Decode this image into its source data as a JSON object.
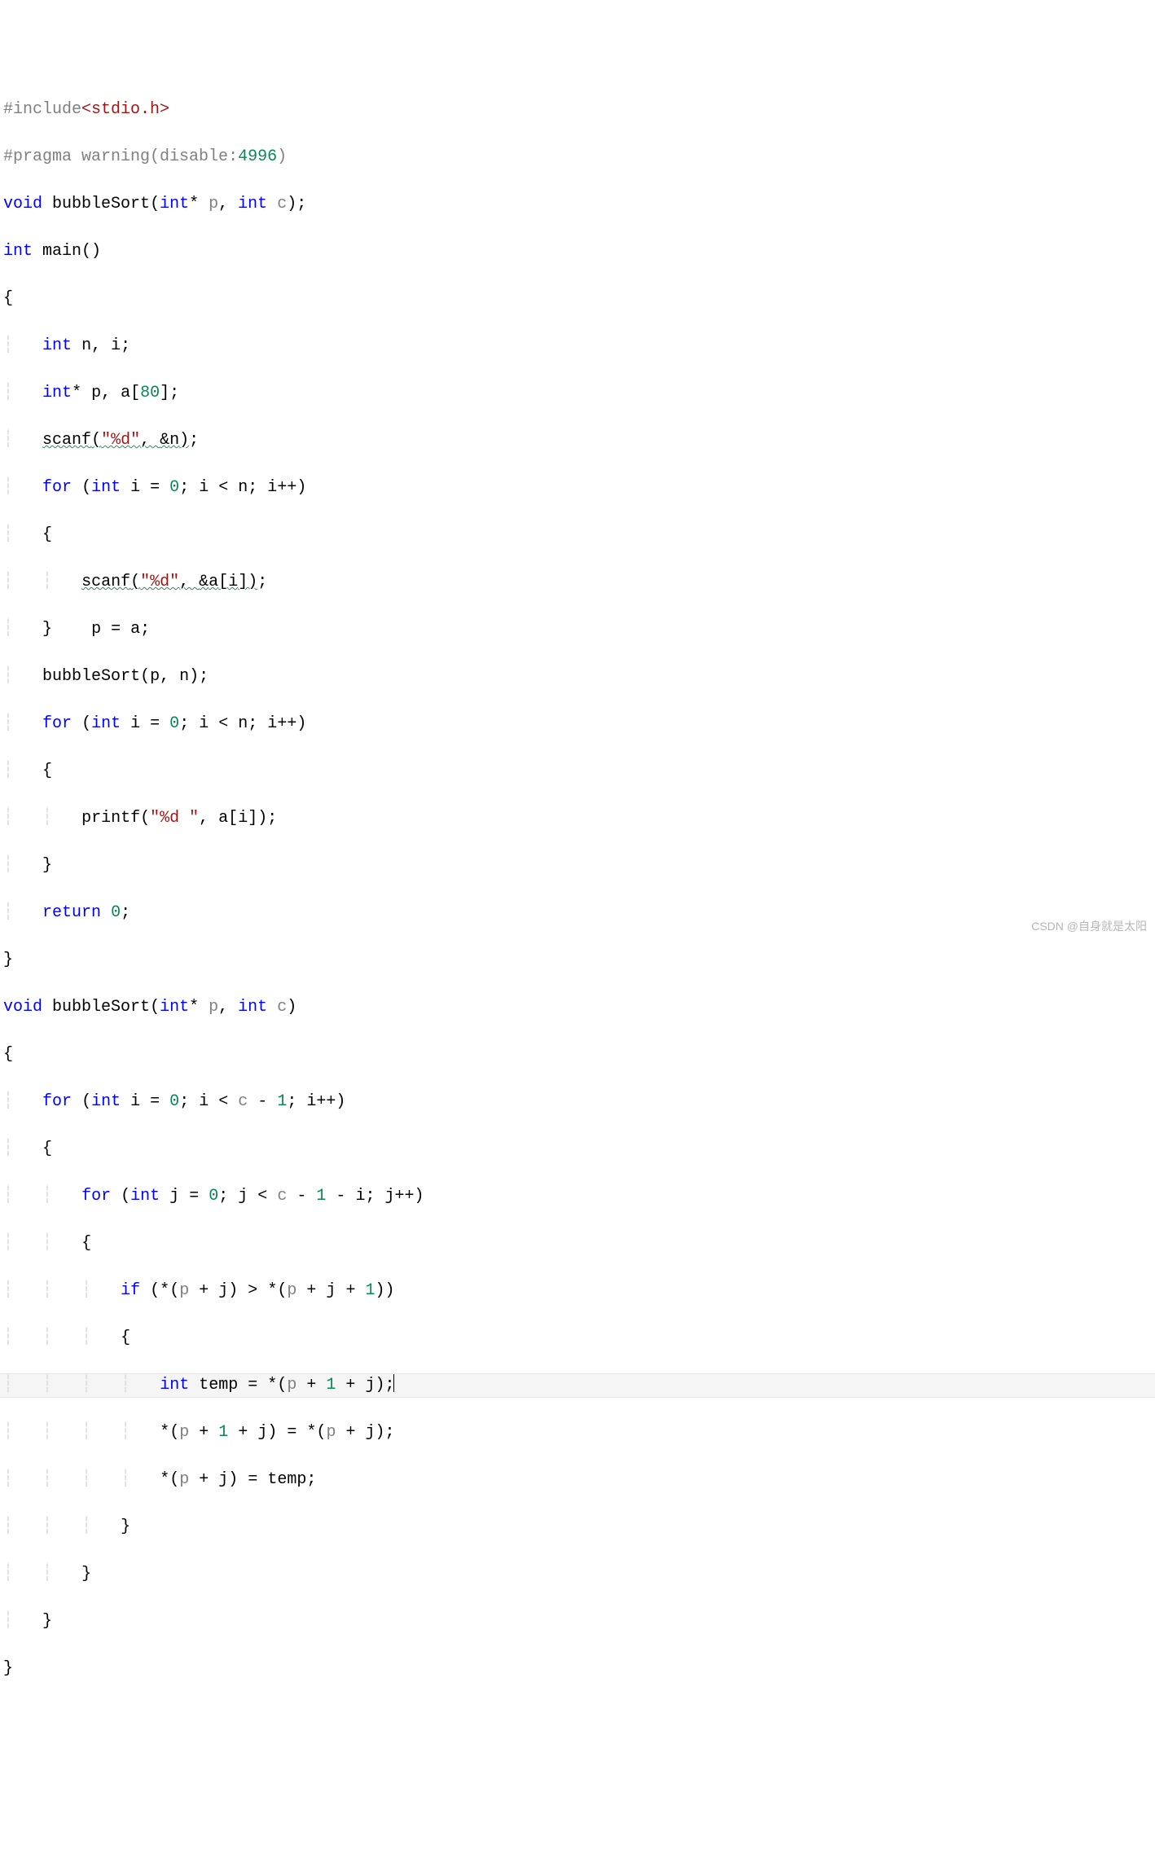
{
  "watermark": "CSDN @自身就是太阳",
  "tokens": {
    "hash_include": "#include",
    "stdio": "<stdio.h>",
    "pragma_warning": "#pragma warning",
    "disable": "disable",
    "colon": ":",
    "num_4996": "4996",
    "void": "void",
    "bubbleSort": "bubbleSort",
    "int": "int",
    "star": "*",
    "p": "p",
    "comma_sp": ", ",
    "c": "c",
    "main": "main",
    "n": "n",
    "i": "i",
    "a": "a",
    "eighty": "80",
    "scanf": "scanf",
    "fmt_d": "\"%d\"",
    "amp": "&",
    "for": "for",
    "eq": "=",
    "zero": "0",
    "lt": "<",
    "semicolon": ";",
    "plusplus": "++",
    "fmt_d_sp": "\"%d \"",
    "printf": "printf",
    "return": "return",
    "one": "1",
    "j": "j",
    "minus": "-",
    "plus": "+",
    "if": "if",
    "gt": ">",
    "temp": "temp",
    "lparen": "(",
    "rparen": ")",
    "lbrace": "{",
    "rbrace": "}",
    "lbracket": "[",
    "rbracket": "]"
  }
}
